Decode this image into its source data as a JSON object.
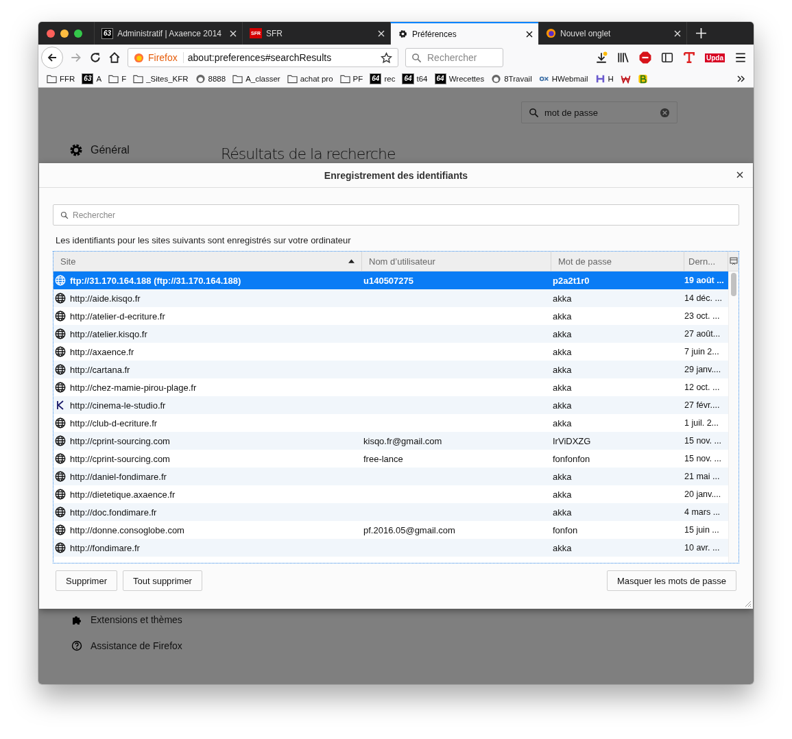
{
  "tabs": [
    {
      "title": "Administratif | Axaence 2014",
      "kind": "badge",
      "badge": "63",
      "selected": false
    },
    {
      "title": "SFR",
      "kind": "sfr",
      "badge": "SFR",
      "selected": false
    },
    {
      "title": "Préférences",
      "kind": "gear",
      "selected": true
    },
    {
      "title": "Nouvel onglet",
      "kind": "firefox",
      "selected": false
    }
  ],
  "navbar": {
    "identity": "Firefox",
    "url": "about:preferences#searchResults",
    "search_placeholder": "Rechercher",
    "update_badge": "Upda"
  },
  "bookmarks": [
    {
      "kind": "folder",
      "label": "FFR"
    },
    {
      "kind": "badge",
      "badge": "63",
      "label": "A"
    },
    {
      "kind": "folder",
      "label": "F"
    },
    {
      "kind": "folder",
      "label": "_Sites_KFR"
    },
    {
      "kind": "circle",
      "label": "8888"
    },
    {
      "kind": "folder",
      "label": "A_classer"
    },
    {
      "kind": "folder",
      "label": "achat pro"
    },
    {
      "kind": "folder",
      "label": "PF"
    },
    {
      "kind": "badge",
      "badge": "64",
      "label": "rec"
    },
    {
      "kind": "badge",
      "badge": "64",
      "label": "t64"
    },
    {
      "kind": "badge",
      "badge": "64",
      "label": "Wrecettes"
    },
    {
      "kind": "circle",
      "label": "8Travail"
    },
    {
      "kind": "ox",
      "label": "HWebmail"
    },
    {
      "kind": "h",
      "label": "H"
    },
    {
      "kind": "w"
    },
    {
      "kind": "b"
    }
  ],
  "preferences": {
    "search_value": "mot de passe",
    "heading": "Résultats de la recherche",
    "categories": [
      {
        "label": "Général"
      }
    ],
    "bottom_categories": [
      {
        "kind": "puzzle",
        "label": "Extensions et thèmes"
      },
      {
        "kind": "help",
        "label": "Assistance de Firefox"
      }
    ]
  },
  "dialog": {
    "title": "Enregistrement des identifiants",
    "search_placeholder": "Rechercher",
    "description": "Les identifiants pour les sites suivants sont enregistrés sur votre ordinateur",
    "columns": [
      "Site",
      "Nom d’utilisateur",
      "Mot de passe",
      "Dern..."
    ],
    "rows": [
      {
        "kind": "globe",
        "site": "ftp://31.170.164.188 (ftp://31.170.164.188)",
        "user": "u140507275",
        "password": "p2a2t1r0",
        "last": "19 août ...",
        "selected": true
      },
      {
        "kind": "globe",
        "site": "http://aide.kisqo.fr",
        "user": "",
        "password": "akka",
        "last": "14 déc. ...",
        "selected": false
      },
      {
        "kind": "globe",
        "site": "http://atelier-d-ecriture.fr",
        "user": "",
        "password": "akka",
        "last": "23 oct. ...",
        "selected": false
      },
      {
        "kind": "globe",
        "site": "http://atelier.kisqo.fr",
        "user": "",
        "password": "akka",
        "last": "27 août...",
        "selected": false
      },
      {
        "kind": "globe",
        "site": "http://axaence.fr",
        "user": "",
        "password": "akka",
        "last": "7 juin 2...",
        "selected": false
      },
      {
        "kind": "globe",
        "site": "http://cartana.fr",
        "user": "",
        "password": "akka",
        "last": "29 janv....",
        "selected": false
      },
      {
        "kind": "globe",
        "site": "http://chez-mamie-pirou-plage.fr",
        "user": "",
        "password": "akka",
        "last": "12 oct. ...",
        "selected": false
      },
      {
        "kind": "k",
        "site": "http://cinema-le-studio.fr",
        "user": "",
        "password": "akka",
        "last": "27 févr....",
        "selected": false
      },
      {
        "kind": "globe",
        "site": "http://club-d-ecriture.fr",
        "user": "",
        "password": "akka",
        "last": "1 juil. 2...",
        "selected": false
      },
      {
        "kind": "globe",
        "site": "http://cprint-sourcing.com",
        "user": "kisqo.fr@gmail.com",
        "password": "IrViDXZG",
        "last": "15 nov. ...",
        "selected": false
      },
      {
        "kind": "globe",
        "site": "http://cprint-sourcing.com",
        "user": "free-lance",
        "password": "fonfonfon",
        "last": "15 nov. ...",
        "selected": false
      },
      {
        "kind": "globe",
        "site": "http://daniel-fondimare.fr",
        "user": "",
        "password": "akka",
        "last": "21 mai ...",
        "selected": false
      },
      {
        "kind": "globe",
        "site": "http://dietetique.axaence.fr",
        "user": "",
        "password": "akka",
        "last": "20 janv....",
        "selected": false
      },
      {
        "kind": "globe",
        "site": "http://doc.fondimare.fr",
        "user": "",
        "password": "akka",
        "last": "4 mars ...",
        "selected": false
      },
      {
        "kind": "globe",
        "site": "http://donne.consoglobe.com",
        "user": "pf.2016.05@gmail.com",
        "password": "fonfon",
        "last": "15 juin ...",
        "selected": false
      },
      {
        "kind": "globe",
        "site": "http://fondimare.fr",
        "user": "",
        "password": "akka",
        "last": "10 avr. ...",
        "selected": false
      }
    ],
    "buttons_left": [
      "Supprimer",
      "Tout supprimer"
    ],
    "button_right": "Masquer les mots de passe"
  }
}
